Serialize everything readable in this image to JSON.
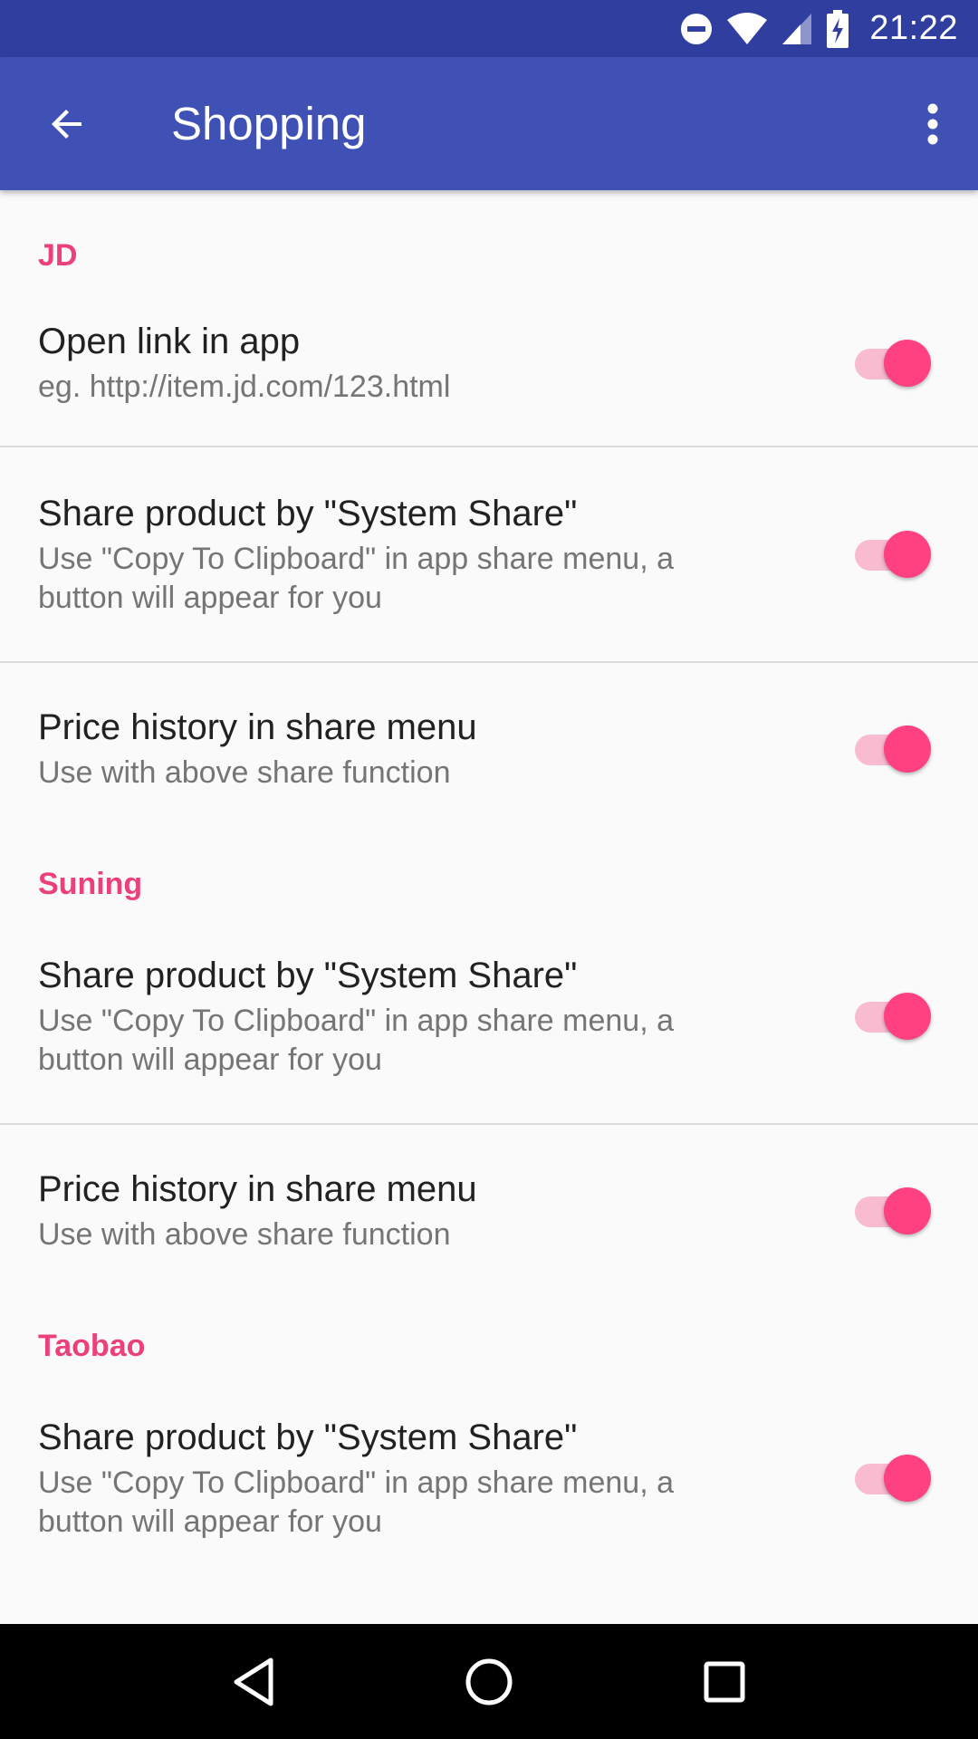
{
  "status_bar": {
    "time": "21:22",
    "icons": [
      "do-not-disturb-icon",
      "wifi-icon",
      "cellular-signal-icon",
      "battery-charging-icon"
    ]
  },
  "app_bar": {
    "title": "Shopping",
    "back_icon": "arrow-back-icon",
    "menu_icon": "more-vert-icon"
  },
  "colors": {
    "status_bar": "#303f9f",
    "app_bar": "#3f51b5",
    "accent": "#ff4081",
    "category_text": "#ec407a"
  },
  "sections": [
    {
      "category": "JD",
      "items": [
        {
          "title": "Open link in app",
          "summary": "eg. http://item.jd.com/123.html",
          "enabled": true
        },
        {
          "title": "Share product by \"System Share\"",
          "summary": "Use \"Copy To Clipboard\" in app share menu, a button will appear for you",
          "enabled": true
        },
        {
          "title": "Price history in share menu",
          "summary": "Use with above share function",
          "enabled": true
        }
      ]
    },
    {
      "category": "Suning",
      "items": [
        {
          "title": "Share product by \"System Share\"",
          "summary": "Use \"Copy To Clipboard\" in app share menu, a button will appear for you",
          "enabled": true
        },
        {
          "title": "Price history in share menu",
          "summary": "Use with above share function",
          "enabled": true
        }
      ]
    },
    {
      "category": "Taobao",
      "items": [
        {
          "title": "Share product by \"System Share\"",
          "summary": "Use \"Copy To Clipboard\" in app share menu, a button will appear for you",
          "enabled": true
        }
      ]
    }
  ],
  "nav_bar": {
    "back_icon": "nav-back-icon",
    "home_icon": "nav-home-icon",
    "recents_icon": "nav-recents-icon"
  }
}
